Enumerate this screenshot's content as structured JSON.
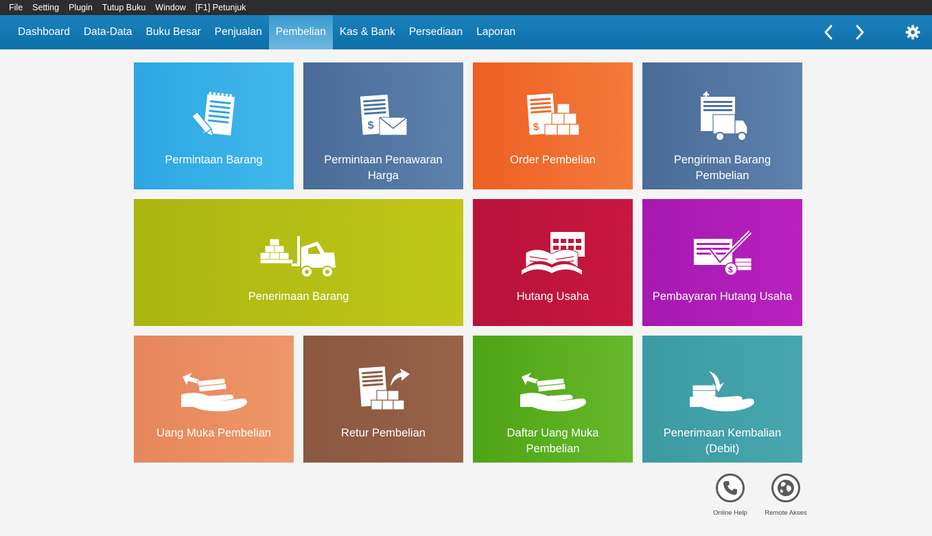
{
  "menu": [
    "File",
    "Setting",
    "Plugin",
    "Tutup Buku",
    "Window",
    "[F1] Petunjuk"
  ],
  "tabs": [
    "Dashboard",
    "Data-Data",
    "Buku Besar",
    "Penjualan",
    "Pembelian",
    "Kas & Bank",
    "Persediaan",
    "Laporan"
  ],
  "active_tab": "Pembelian",
  "nav_icons": [
    "chevron-left-icon",
    "chevron-right-icon",
    "gear-icon"
  ],
  "tiles": [
    {
      "label": "Permintaan Barang",
      "color": "#34aee6",
      "icon": "notepad-pencil-icon"
    },
    {
      "label": "Permintaan Penawaran Harga",
      "color": "#4f74a0",
      "icon": "quote-envelope-icon"
    },
    {
      "label": "Order Pembelian",
      "color": "#f06a2a",
      "icon": "order-boxes-icon"
    },
    {
      "label": "Pengiriman Barang Pembelian",
      "color": "#4f74a0",
      "icon": "delivery-truck-icon"
    },
    {
      "label": "Penerimaan Barang",
      "color": "#b3bd14",
      "icon": "forklift-icon"
    },
    {
      "label": "Hutang Usaha",
      "color": "#c0143a",
      "icon": "calendar-book-icon"
    },
    {
      "label": "Pembayaran Hutang Usaha",
      "color": "#b21cb8",
      "icon": "payment-check-icon"
    },
    {
      "label": "Uang Muka Pembelian",
      "color": "#e98a60",
      "icon": "hand-money-icon"
    },
    {
      "label": "Retur Pembelian",
      "color": "#8f5c43",
      "icon": "return-boxes-icon"
    },
    {
      "label": "Daftar Uang Muka Pembelian",
      "color": "#55ad1c",
      "icon": "hand-money-list-icon"
    },
    {
      "label": "Penerimaan Kembalian (Debit)",
      "color": "#42a0a8",
      "icon": "hand-receive-icon"
    }
  ],
  "help": [
    {
      "label": "Online Help",
      "icon": "phone-icon"
    },
    {
      "label": "Remote Akses",
      "icon": "globe-icon"
    }
  ]
}
